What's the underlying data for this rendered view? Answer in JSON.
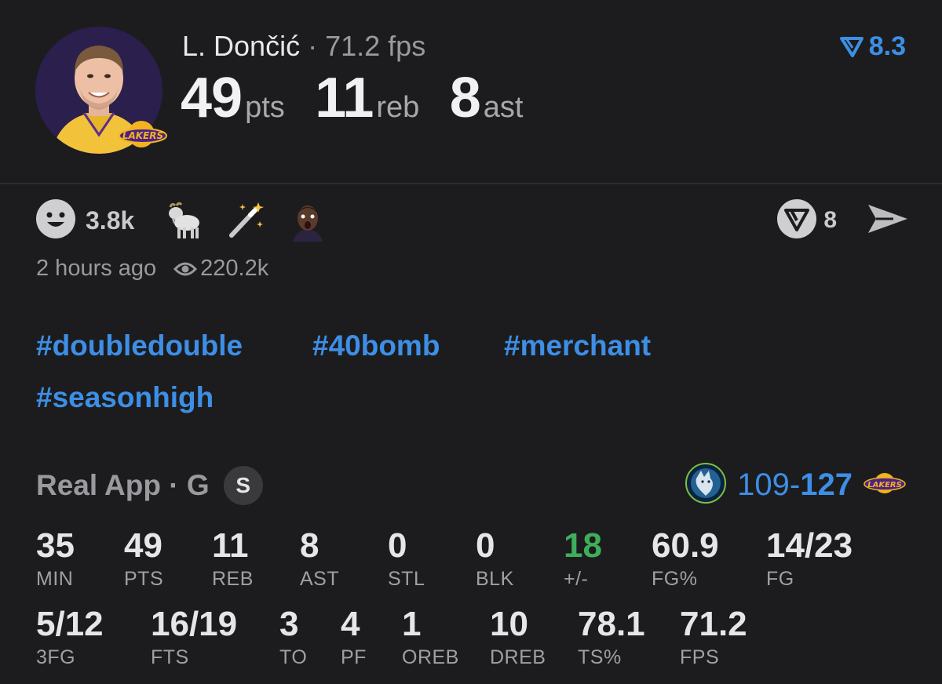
{
  "header": {
    "player_name": "L. Dončić",
    "separator": "·",
    "fps_label": "71.2 fps",
    "stats": [
      {
        "value": "49",
        "unit": "pts"
      },
      {
        "value": "11",
        "unit": "reb"
      },
      {
        "value": "8",
        "unit": "ast"
      }
    ],
    "rating": "8.3",
    "accent_color": "#3d8fe6"
  },
  "reactions": {
    "laugh_count": "3.8k",
    "emojis": [
      "goat-emoji",
      "magic-wand-emoji",
      "shocked-face-emoji"
    ],
    "vote_count": "8"
  },
  "meta": {
    "posted": "2 hours ago",
    "views": "220.2k"
  },
  "hashtags": [
    "#doubledouble",
    "#40bomb",
    "#merchant",
    "#seasonhigh"
  ],
  "game": {
    "label": "Real App · G",
    "badge": "S",
    "score_away": "109",
    "score_dash": "-",
    "score_home": "127"
  },
  "boxscore": {
    "row1": [
      {
        "value": "35",
        "label": "MIN"
      },
      {
        "value": "49",
        "label": "PTS"
      },
      {
        "value": "11",
        "label": "REB"
      },
      {
        "value": "8",
        "label": "AST"
      },
      {
        "value": "0",
        "label": "STL"
      },
      {
        "value": "0",
        "label": "BLK"
      },
      {
        "value": "18",
        "label": "+/-"
      },
      {
        "value": "60.9",
        "label": "FG%"
      },
      {
        "value": "14/23",
        "label": "FG"
      }
    ],
    "row2": [
      {
        "value": "5/12",
        "label": "3FG"
      },
      {
        "value": "16/19",
        "label": "FTS"
      },
      {
        "value": "3",
        "label": "TO"
      },
      {
        "value": "4",
        "label": "PF"
      },
      {
        "value": "1",
        "label": "OREB"
      },
      {
        "value": "10",
        "label": "DREB"
      },
      {
        "value": "78.1",
        "label": "TS%"
      },
      {
        "value": "71.2",
        "label": "FPS"
      }
    ],
    "positive_color": "#3fae5a"
  }
}
